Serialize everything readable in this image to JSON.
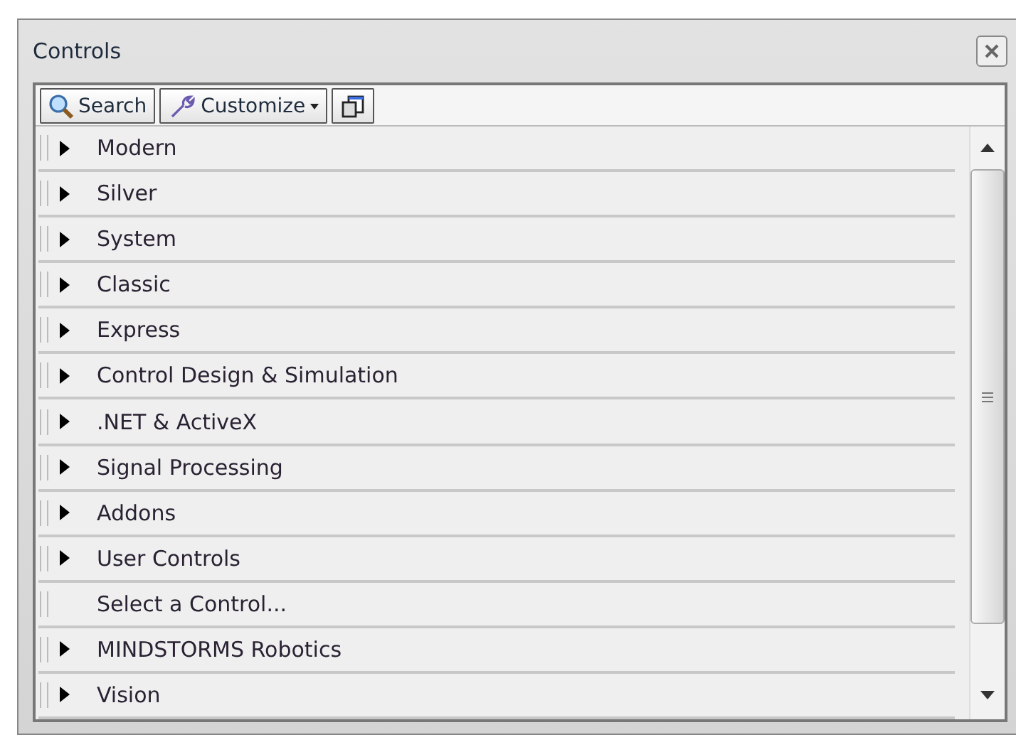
{
  "window": {
    "title": "Controls"
  },
  "toolbar": {
    "buttons": [
      {
        "kind": "search",
        "label": "Search"
      },
      {
        "kind": "customize",
        "label": "Customize"
      },
      {
        "kind": "window"
      }
    ]
  },
  "palette": [
    {
      "kind": "category",
      "label": "Modern"
    },
    {
      "kind": "category",
      "label": "Silver"
    },
    {
      "kind": "category",
      "label": "System"
    },
    {
      "kind": "category",
      "label": "Classic"
    },
    {
      "kind": "category",
      "label": "Express"
    },
    {
      "kind": "category",
      "label": "Control Design & Simulation"
    },
    {
      "kind": "category",
      "label": ".NET & ActiveX"
    },
    {
      "kind": "category",
      "label": "Signal Processing"
    },
    {
      "kind": "category",
      "label": "Addons"
    },
    {
      "kind": "category",
      "label": "User Controls"
    },
    {
      "kind": "action",
      "label": "Select a Control..."
    },
    {
      "kind": "category",
      "label": "MINDSTORMS Robotics"
    },
    {
      "kind": "category",
      "label": "Vision"
    }
  ]
}
